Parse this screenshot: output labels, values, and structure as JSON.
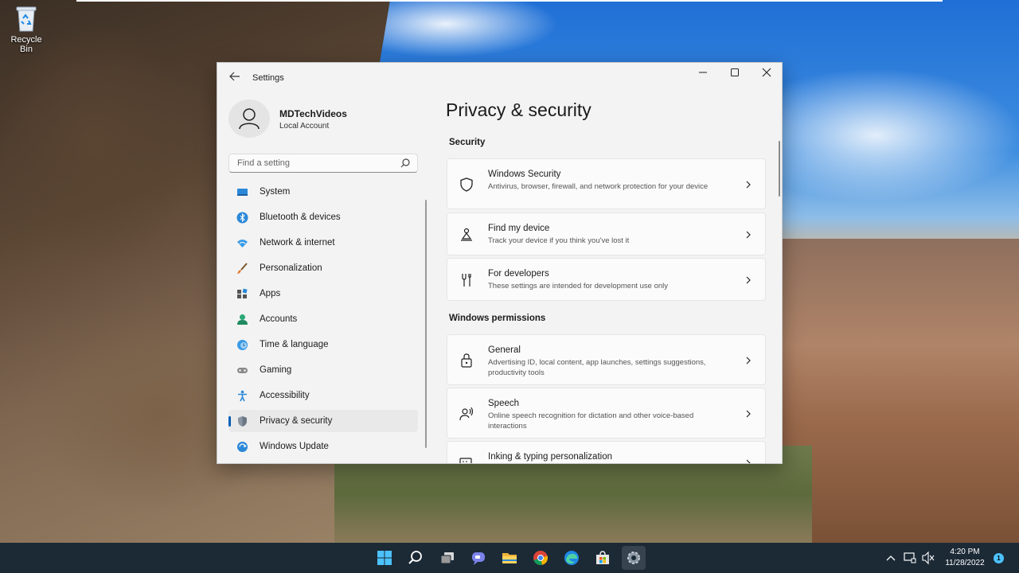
{
  "desktop": {
    "recycle_bin_label": "Recycle Bin"
  },
  "window": {
    "title": "Settings",
    "controls": {
      "minimize_icon": "minimize-icon",
      "maximize_icon": "maximize-icon",
      "close_icon": "close-icon"
    }
  },
  "profile": {
    "name": "MDTechVideos",
    "account_type": "Local Account"
  },
  "search": {
    "placeholder": "Find a setting"
  },
  "sidebar": {
    "items": [
      {
        "label": "System",
        "icon": "system-icon"
      },
      {
        "label": "Bluetooth & devices",
        "icon": "bluetooth-icon"
      },
      {
        "label": "Network & internet",
        "icon": "network-icon"
      },
      {
        "label": "Personalization",
        "icon": "brush-icon"
      },
      {
        "label": "Apps",
        "icon": "apps-icon"
      },
      {
        "label": "Accounts",
        "icon": "accounts-icon"
      },
      {
        "label": "Time & language",
        "icon": "globe-icon"
      },
      {
        "label": "Gaming",
        "icon": "gamepad-icon"
      },
      {
        "label": "Accessibility",
        "icon": "accessibility-icon"
      },
      {
        "label": "Privacy & security",
        "icon": "shield-icon",
        "selected": true
      },
      {
        "label": "Windows Update",
        "icon": "update-icon"
      }
    ]
  },
  "content": {
    "title": "Privacy & security",
    "sections": [
      {
        "heading": "Security",
        "cards": [
          {
            "title": "Windows Security",
            "description": "Antivirus, browser, firewall, and network protection for your device",
            "icon": "shield-outline-icon"
          },
          {
            "title": "Find my device",
            "description": "Track your device if you think you've lost it",
            "icon": "person-pin-icon"
          },
          {
            "title": "For developers",
            "description": "These settings are intended for development use only",
            "icon": "developer-tools-icon"
          }
        ]
      },
      {
        "heading": "Windows permissions",
        "cards": [
          {
            "title": "General",
            "description": "Advertising ID, local content, app launches, settings suggestions, productivity tools",
            "icon": "lock-icon"
          },
          {
            "title": "Speech",
            "description": "Online speech recognition for dictation and other voice-based interactions",
            "icon": "speech-icon"
          },
          {
            "title": "Inking & typing personalization",
            "description": "",
            "icon": "keyboard-pen-icon"
          }
        ]
      }
    ]
  },
  "taskbar": {
    "apps": [
      "start-icon",
      "search-icon",
      "task-view-icon",
      "chat-icon",
      "file-explorer-icon",
      "chrome-icon",
      "edge-icon",
      "store-icon",
      "settings-icon"
    ],
    "active_app": "settings-icon",
    "time": "4:20 PM",
    "date": "11/28/2022",
    "notification_count": "1"
  },
  "colors": {
    "accent": "#005fb8",
    "window_bg": "#f3f3f3",
    "card_bg": "#fbfbfb",
    "taskbar_bg": "#1c2a36"
  }
}
